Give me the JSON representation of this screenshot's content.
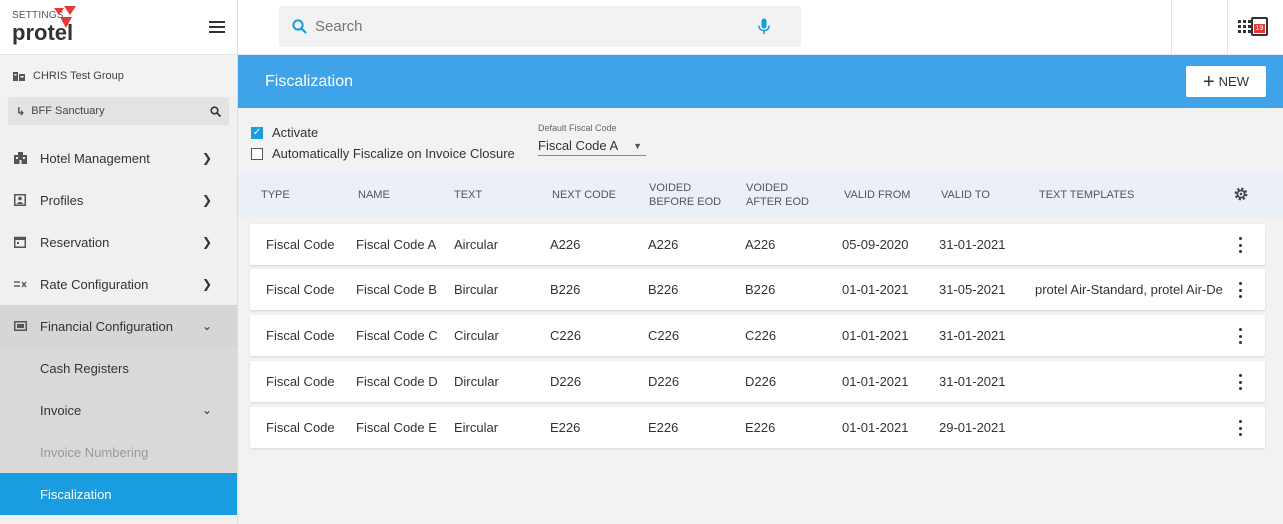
{
  "app": {
    "settings_label": "SETTINGS",
    "brand": "protel"
  },
  "org": {
    "group": "CHRIS Test Group",
    "hotel": "BFF Sanctuary"
  },
  "nav": {
    "items": [
      {
        "label": "Hotel Management",
        "icon": "hotel-icon"
      },
      {
        "label": "Profiles",
        "icon": "profile-icon"
      },
      {
        "label": "Reservation",
        "icon": "calendar-icon"
      },
      {
        "label": "Rate Configuration",
        "icon": "rate-icon"
      },
      {
        "label": "Financial Configuration",
        "icon": "finance-icon"
      }
    ],
    "sub_items": [
      {
        "label": "Cash Registers"
      },
      {
        "label": "Invoice"
      },
      {
        "label": "Invoice Numbering"
      },
      {
        "label": "Fiscalization"
      }
    ]
  },
  "search": {
    "placeholder": "Search"
  },
  "calendar_day": "19",
  "page": {
    "title": "Fiscalization",
    "new_label": "NEW"
  },
  "filters": {
    "activate_label": "Activate",
    "activate_checked": true,
    "auto_fiscalize_label": "Automatically Fiscalize on Invoice Closure",
    "auto_fiscalize_checked": false,
    "default_fiscal_code_label": "Default Fiscal Code",
    "default_fiscal_code_value": "Fiscal Code A"
  },
  "table": {
    "headers": {
      "type": "TYPE",
      "name": "NAME",
      "text": "TEXT",
      "next_code": "NEXT CODE",
      "voided_before_1": "VOIDED",
      "voided_before_2": "BEFORE EOD",
      "voided_after_1": "VOIDED",
      "voided_after_2": "AFTER EOD",
      "valid_from": "VALID FROM",
      "valid_to": "VALID TO",
      "text_templates": "TEXT TEMPLATES"
    },
    "rows": [
      {
        "type": "Fiscal Code",
        "name": "Fiscal Code A",
        "text": "Aircular",
        "next_code": "A226",
        "voided_before": "A226",
        "voided_after": "A226",
        "valid_from": "05-09-2020",
        "valid_to": "31-01-2021",
        "text_templates": ""
      },
      {
        "type": "Fiscal Code",
        "name": "Fiscal Code B",
        "text": "Bircular",
        "next_code": "B226",
        "voided_before": "B226",
        "voided_after": "B226",
        "valid_from": "01-01-2021",
        "valid_to": "31-05-2021",
        "text_templates": "protel Air-Standard, protel Air-De"
      },
      {
        "type": "Fiscal Code",
        "name": "Fiscal Code C",
        "text": "Circular",
        "next_code": "C226",
        "voided_before": "C226",
        "voided_after": "C226",
        "valid_from": "01-01-2021",
        "valid_to": "31-01-2021",
        "text_templates": ""
      },
      {
        "type": "Fiscal Code",
        "name": "Fiscal Code D",
        "text": "Dircular",
        "next_code": "D226",
        "voided_before": "D226",
        "voided_after": "D226",
        "valid_from": "01-01-2021",
        "valid_to": "31-01-2021",
        "text_templates": ""
      },
      {
        "type": "Fiscal Code",
        "name": "Fiscal Code E",
        "text": "Eircular",
        "next_code": "E226",
        "voided_before": "E226",
        "voided_after": "E226",
        "valid_from": "01-01-2021",
        "valid_to": "29-01-2021",
        "text_templates": ""
      }
    ]
  },
  "colors": {
    "accent": "#3ea3e8",
    "active_nav": "#1a9de0",
    "brand_red": "#e53935"
  }
}
